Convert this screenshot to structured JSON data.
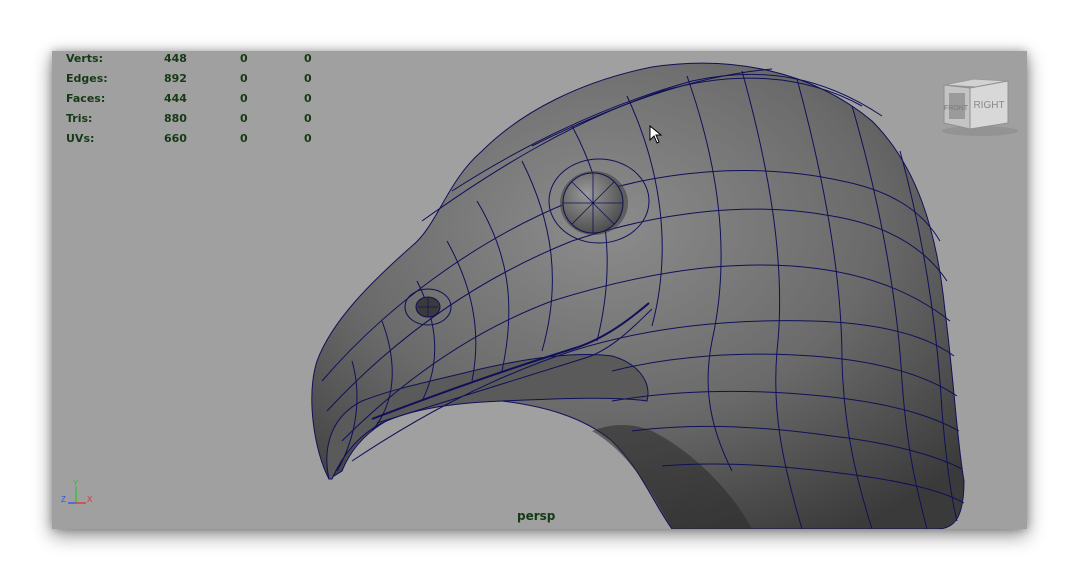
{
  "stats": {
    "rows": [
      {
        "label": "Verts:",
        "v1": "448",
        "v2": "0",
        "v3": "0"
      },
      {
        "label": "Edges:",
        "v1": "892",
        "v2": "0",
        "v3": "0"
      },
      {
        "label": "Faces:",
        "v1": "444",
        "v2": "0",
        "v3": "0"
      },
      {
        "label": "Tris:",
        "v1": "880",
        "v2": "0",
        "v3": "0"
      },
      {
        "label": "UVs:",
        "v1": "660",
        "v2": "0",
        "v3": "0"
      }
    ]
  },
  "camera": {
    "name": "persp"
  },
  "viewcube": {
    "front_label": "FRONT",
    "right_label": "RIGHT"
  },
  "axis": {
    "y": "Y",
    "z": "Z",
    "x": "X"
  },
  "colors": {
    "viewport_bg": "#a0a0a0",
    "wireframe": "#10105a",
    "hud_text": "#153a15"
  }
}
